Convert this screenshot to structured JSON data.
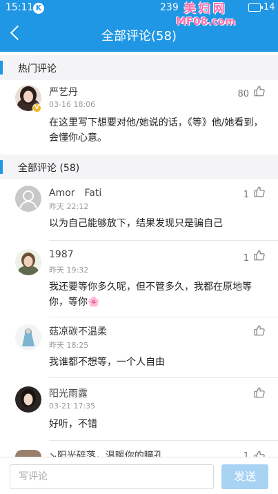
{
  "status_bar": {
    "time": "15:11",
    "k_badge": "K",
    "speed": "239",
    "battery": "14"
  },
  "watermark": {
    "line1": "美妇网",
    "line2": "MF08.com"
  },
  "header": {
    "title": "全部评论(58)",
    "back_icon": "chevron-left-icon"
  },
  "hot_section": {
    "label": "热门评论"
  },
  "hot_comment": {
    "name": "严艺丹",
    "date": "03-16 18:06",
    "likes": "80",
    "text": "在这里写下想要对他/她说的话，《等》他/她看到，会懂你心意。"
  },
  "all_section": {
    "label": "全部评论 (58)"
  },
  "comments": [
    {
      "name": "Amor　Fati",
      "date": "昨天 22:12",
      "likes": "1",
      "text": "以为自己能够放下，结果发现只是骗自己"
    },
    {
      "name": "1987",
      "date": "昨天 19:32",
      "likes": "1",
      "text": "我还要等你多久呢，但不管多久，我都在原地等你，等你🌸"
    },
    {
      "name": "菇凉碳不温柔",
      "date": "昨天 18:25",
      "likes": "",
      "text": "我谁都不想等，一个人自由"
    },
    {
      "name": "阳光雨露",
      "date": "03-21 17:35",
      "likes": "",
      "text": "好听，不错"
    },
    {
      "name": "↘阳光碎落，温暖你的瞳孔",
      "date": "",
      "likes": "1",
      "text": ""
    }
  ],
  "bottom_bar": {
    "input_placeholder": "写评论",
    "send_label": "发送"
  },
  "colors": {
    "accent": "#1f97e4",
    "send_disabled": "#a8d3f3"
  }
}
